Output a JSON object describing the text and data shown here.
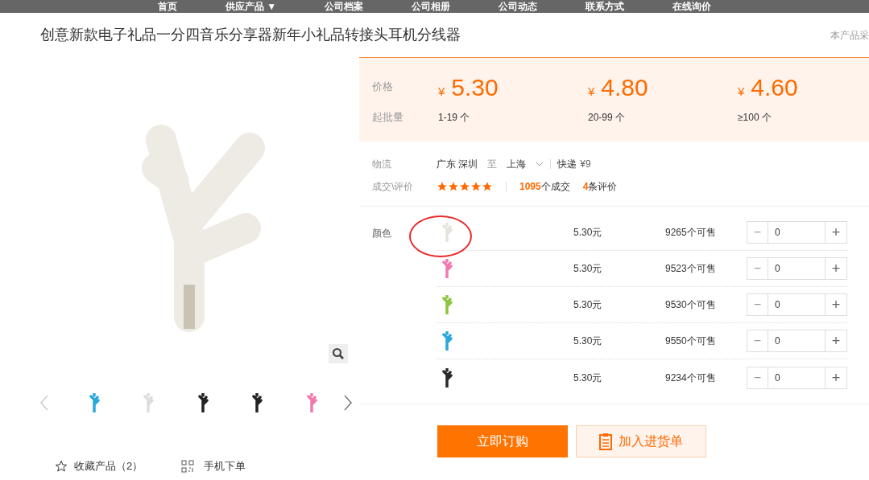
{
  "nav": [
    "首页",
    "供应产品 ▼",
    "公司档案",
    "公司相册",
    "公司动态",
    "联系方式",
    "在线询价"
  ],
  "title": "创意新款电子礼品一分四音乐分享器新年小礼品转接头耳机分线器",
  "side_note": "本产品采",
  "price_label": "价格",
  "qty_label": "起批量",
  "tiers": [
    {
      "currency": "¥",
      "price": "5.30",
      "qty": "1-19 个"
    },
    {
      "currency": "¥",
      "price": "4.80",
      "qty": "20-99 个"
    },
    {
      "currency": "¥",
      "price": "4.60",
      "qty": "≥100 个"
    }
  ],
  "logistics": {
    "label": "物流",
    "from": "广东 深圳",
    "to_word": "至",
    "to": "上海",
    "method": "快递",
    "fee": "¥9"
  },
  "deals": {
    "label": "成交\\评价",
    "stars": 5,
    "count": "1095",
    "count_suffix": "个成交",
    "reviews": "4",
    "reviews_suffix": "条评价"
  },
  "color_label": "颜色",
  "variants": [
    {
      "color": "#e6e3de",
      "price": "5.30元",
      "stock": "9265个可售",
      "qty": "0",
      "circled": true
    },
    {
      "color": "#f07ab0",
      "price": "5.30元",
      "stock": "9523个可售",
      "qty": "0",
      "circled": false
    },
    {
      "color": "#8cc63f",
      "price": "5.30元",
      "stock": "9530个可售",
      "qty": "0",
      "circled": false
    },
    {
      "color": "#29a8dc",
      "price": "5.30元",
      "stock": "9550个可售",
      "qty": "0",
      "circled": false
    },
    {
      "color": "#2a2a2a",
      "price": "5.30元",
      "stock": "9234个可售",
      "qty": "0",
      "circled": false
    }
  ],
  "stepper": {
    "minus": "−",
    "plus": "+"
  },
  "buttons": {
    "order": "立即订购",
    "cart": "加入进货单"
  },
  "favorite": "收藏产品（2）",
  "mobile": "手机下单"
}
